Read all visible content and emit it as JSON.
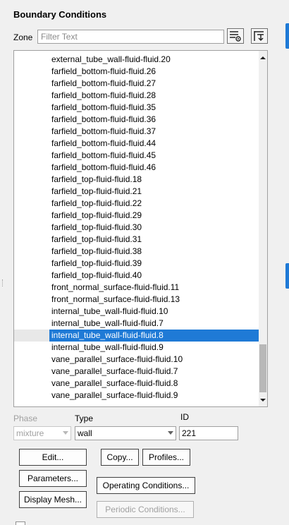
{
  "panel": {
    "title": "Boundary Conditions"
  },
  "zone": {
    "label": "Zone",
    "filter_placeholder": "Filter Text",
    "filter_value": ""
  },
  "zones": [
    "external_tube_wall-fluid-fluid.20",
    "farfield_bottom-fluid-fluid.26",
    "farfield_bottom-fluid-fluid.27",
    "farfield_bottom-fluid-fluid.28",
    "farfield_bottom-fluid-fluid.35",
    "farfield_bottom-fluid-fluid.36",
    "farfield_bottom-fluid-fluid.37",
    "farfield_bottom-fluid-fluid.44",
    "farfield_bottom-fluid-fluid.45",
    "farfield_bottom-fluid-fluid.46",
    "farfield_top-fluid-fluid.18",
    "farfield_top-fluid-fluid.21",
    "farfield_top-fluid-fluid.22",
    "farfield_top-fluid-fluid.29",
    "farfield_top-fluid-fluid.30",
    "farfield_top-fluid-fluid.31",
    "farfield_top-fluid-fluid.38",
    "farfield_top-fluid-fluid.39",
    "farfield_top-fluid-fluid.40",
    "front_normal_surface-fluid-fluid.11",
    "front_normal_surface-fluid-fluid.13",
    "internal_tube_wall-fluid-fluid.10",
    "internal_tube_wall-fluid-fluid.7",
    "internal_tube_wall-fluid-fluid.8",
    "internal_tube_wall-fluid-fluid.9",
    "vane_parallel_surface-fluid-fluid.10",
    "vane_parallel_surface-fluid-fluid.7",
    "vane_parallel_surface-fluid-fluid.8",
    "vane_parallel_surface-fluid-fluid.9"
  ],
  "selected_zone": "internal_tube_wall-fluid-fluid.8",
  "properties": {
    "phase_label": "Phase",
    "phase_value": "mixture",
    "type_label": "Type",
    "type_value": "wall",
    "id_label": "ID",
    "id_value": "221"
  },
  "buttons": {
    "edit": "Edit...",
    "copy": "Copy...",
    "profiles": "Profiles...",
    "parameters": "Parameters...",
    "operating_conditions": "Operating Conditions...",
    "display_mesh": "Display Mesh...",
    "periodic_conditions": "Periodic Conditions..."
  },
  "colors": {
    "selection": "#1f7ad6",
    "panel_bg": "#f0f0f0"
  },
  "icons": {
    "filter_options": "filter-options-icon",
    "collapse_list": "collapse-list-icon",
    "scroll_up": "scroll-up-icon",
    "scroll_down": "scroll-down-icon"
  }
}
